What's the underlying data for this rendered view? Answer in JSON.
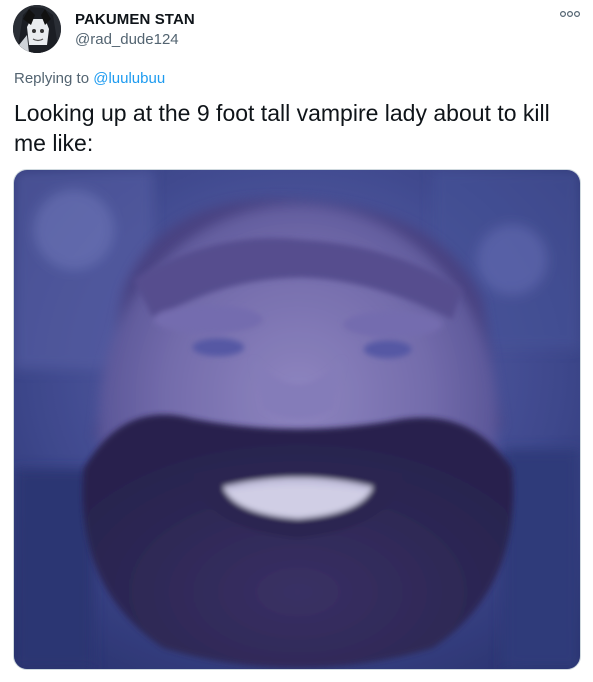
{
  "tweet": {
    "author": {
      "display_name": "PAKUMEN STAN",
      "handle": "@rad_dude124",
      "avatar_icon": "anime-avatar"
    },
    "reply": {
      "prefix": "Replying to ",
      "target": "@luulubuu"
    },
    "text": "Looking up at the 9 foot tall vampire lady about to kill me like:",
    "more_icon": "more-options-icon",
    "media": {
      "type": "photo",
      "icon": "photo-man-looking-up"
    }
  },
  "colors": {
    "text_primary": "#0f1419",
    "text_secondary": "#536471",
    "link": "#1d9bf0",
    "media_tint": "#5a5fa8"
  }
}
